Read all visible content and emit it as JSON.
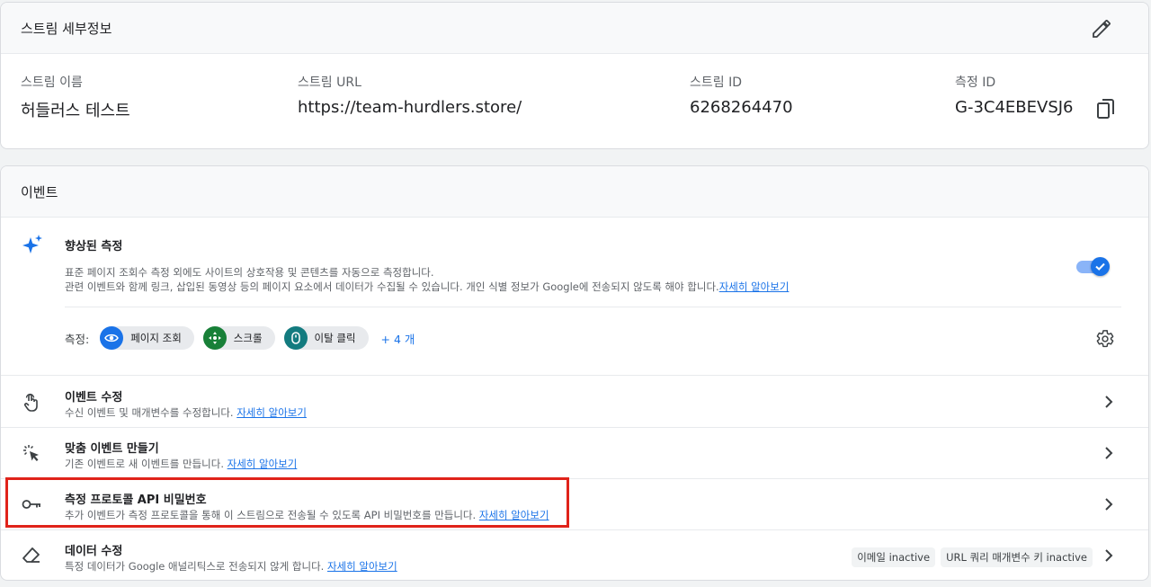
{
  "stream": {
    "header": "스트림 세부정보",
    "fields": [
      {
        "label": "스트림 이름",
        "value": "허들러스 테스트"
      },
      {
        "label": "스트림 URL",
        "value": "https://team-hurdlers.store/"
      },
      {
        "label": "스트림 ID",
        "value": "6268264470"
      },
      {
        "label": "측정 ID",
        "value": "G-3C4EBEVSJ6"
      }
    ]
  },
  "events": {
    "header": "이벤트",
    "enhanced": {
      "title": "향상된 측정",
      "desc1": "표준 페이지 조회수 측정 외에도 사이트의 상호작용 및 콘텐츠를 자동으로 측정합니다.",
      "desc2": "관련 이벤트와 함께 링크, 삽입된 동영상 등의 페이지 요소에서 데이터가 수집될 수 있습니다. 개인 식별 정보가 Google에 전송되지 않도록 해야 합니다.",
      "learn_more": "자세히 알아보기",
      "enabled": true,
      "measure_label": "측정:",
      "chips": [
        {
          "label": "페이지 조회",
          "color": "#1a73e8",
          "icon": "eye-icon"
        },
        {
          "label": "스크롤",
          "color": "#188038",
          "icon": "scroll-icon"
        },
        {
          "label": "이탈 클릭",
          "color": "#137b7f",
          "icon": "mouse-icon"
        }
      ],
      "more": "+ 4 개"
    },
    "rows": [
      {
        "title": "이벤트 수정",
        "desc": "수신 이벤트 및 매개변수를 수정합니다.",
        "link": "자세히 알아보기"
      },
      {
        "title": "맞춤 이벤트 만들기",
        "desc": "기존 이벤트로 새 이벤트를 만듭니다.",
        "link": "자세히 알아보기"
      },
      {
        "title": "측정 프로토콜 API 비밀번호",
        "desc": "추가 이벤트가 측정 프로토콜을 통해 이 스트림으로 전송될 수 있도록 API 비밀번호를 만듭니다.",
        "link": "자세히 알아보기"
      },
      {
        "title": "데이터 수정",
        "desc": "특정 데이터가 Google 애널리틱스로 전송되지 않게 합니다.",
        "link": "자세히 알아보기",
        "tags": [
          "이메일 inactive",
          "URL 쿼리 매개변수 키 inactive"
        ]
      }
    ]
  },
  "colors": {
    "accent": "#1a73e8",
    "highlight": "#e0231a"
  }
}
